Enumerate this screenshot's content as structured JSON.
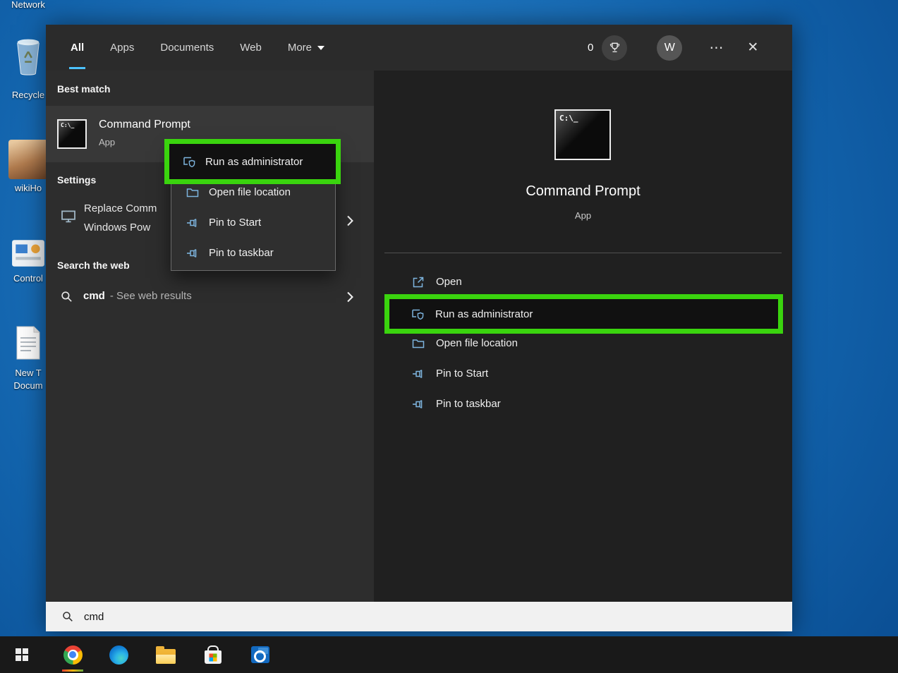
{
  "colors": {
    "highlight_green": "#3ad40e",
    "tab_accent": "#4cc2ff"
  },
  "desktop": {
    "icons": [
      {
        "label": "Network"
      },
      {
        "label": "Recycle"
      },
      {
        "label": "wikiHo"
      },
      {
        "label": "Control"
      },
      {
        "label": "New T",
        "label_line2": "Docum"
      }
    ]
  },
  "window": {
    "tabs": [
      {
        "label": "All"
      },
      {
        "label": "Apps"
      },
      {
        "label": "Documents"
      },
      {
        "label": "Web"
      },
      {
        "label": "More"
      }
    ],
    "header": {
      "rewards_count": "0",
      "avatar_initial": "W",
      "more_glyph": "⋯",
      "close_glyph": "✕"
    },
    "left_panel": {
      "best_match_header": "Best match",
      "best_match": {
        "title": "Command Prompt",
        "subtitle": "App"
      },
      "settings_header": "Settings",
      "settings_item": {
        "line1": "Replace Comm",
        "line2": "Windows Pow"
      },
      "web_header": "Search the web",
      "web_item": {
        "query": "cmd",
        "suffix": "- See web results"
      }
    },
    "context_menu": {
      "items": [
        {
          "label": "Run as administrator"
        },
        {
          "label": "Open file location"
        },
        {
          "label": "Pin to Start"
        },
        {
          "label": "Pin to taskbar"
        }
      ]
    },
    "preview": {
      "title": "Command Prompt",
      "subtitle": "App",
      "actions": [
        {
          "label": "Open"
        },
        {
          "label": "Run as administrator"
        },
        {
          "label": "Open file location"
        },
        {
          "label": "Pin to Start"
        },
        {
          "label": "Pin to taskbar"
        }
      ]
    },
    "search_box": {
      "value": "cmd"
    }
  },
  "taskbar": {
    "items": [
      "start",
      "chrome",
      "edge",
      "file-explorer",
      "store",
      "outlook"
    ]
  }
}
